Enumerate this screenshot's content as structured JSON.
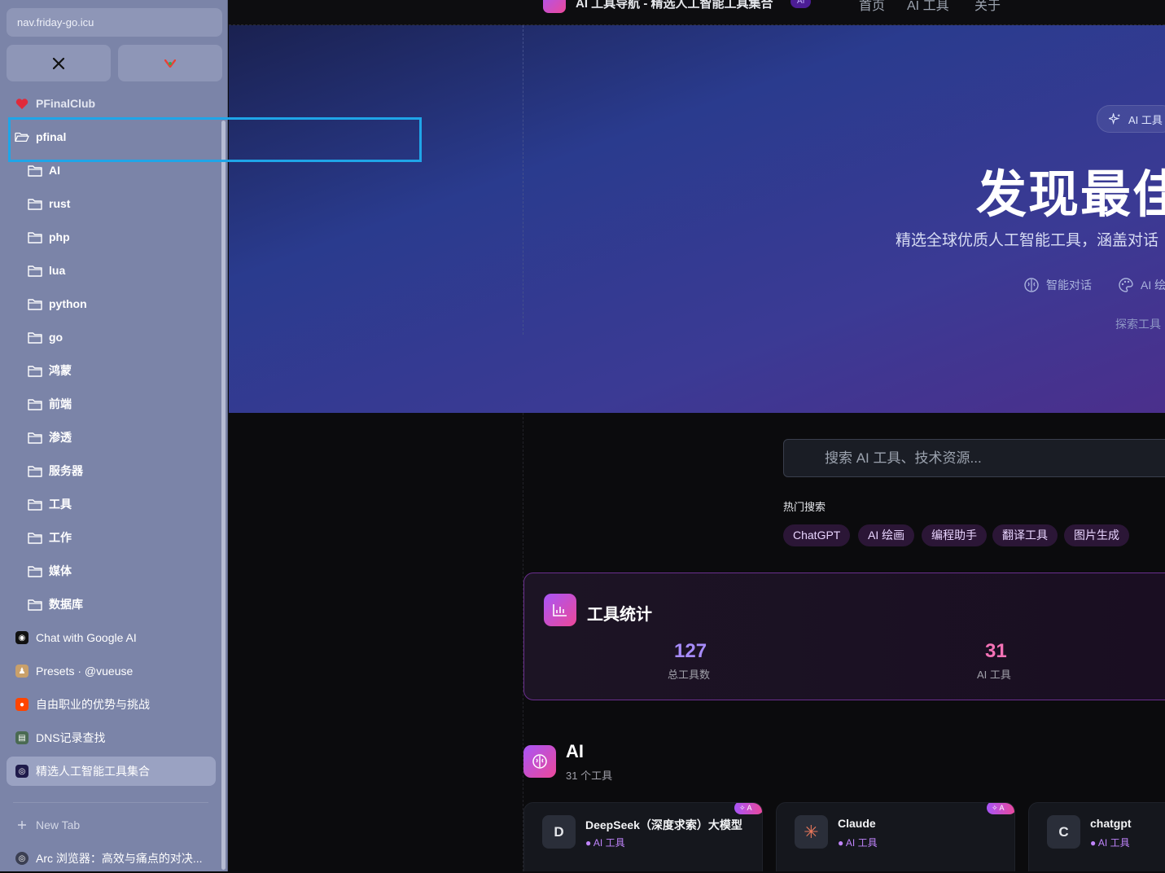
{
  "browser": {
    "url": "nav.friday-go.icu",
    "pinned": [
      {
        "name": "x-icon"
      },
      {
        "name": "google-photos-icon"
      }
    ]
  },
  "sidebar": {
    "top_item": {
      "label": "PFinalClub",
      "icon": "heart-icon"
    },
    "folder": {
      "label": "pfinal",
      "icon": "folder-open-icon"
    },
    "subfolders": [
      "AI",
      "rust",
      "php",
      "lua",
      "python",
      "go",
      "鸿蒙",
      "前端",
      "渗透",
      "服务器",
      "工具",
      "工作",
      "媒体",
      "数据库"
    ],
    "tabs": [
      {
        "label": "Chat with Google AI",
        "icon": "google-ai-icon"
      },
      {
        "label": "Presets · @vueuse",
        "icon": "vueuse-icon"
      },
      {
        "label": "自由职业的优势与挑战",
        "icon": "reddit-icon"
      },
      {
        "label": "DNS记录查找",
        "icon": "dns-icon"
      },
      {
        "label": "精选人工智能工具集合",
        "icon": "ai-nav-icon",
        "active": true
      }
    ],
    "new_tab": "New Tab",
    "bottom_tab": {
      "label": "Arc 浏览器：高效与痛点的对决...",
      "icon": "arc-icon"
    }
  },
  "topnav": {
    "brand": "AI 工具导航 - 精选人工智能工具集合",
    "badge": "AI",
    "links": [
      "首页",
      "AI 工具",
      "关于"
    ]
  },
  "hero": {
    "badge": "AI 工具",
    "title": "发现最佳",
    "subtitle": "精选全球优质人工智能工具，涵盖对话",
    "features": [
      "智能对话",
      "AI 绘"
    ],
    "explore": "探索工具"
  },
  "search": {
    "placeholder": "搜索 AI 工具、技术资源...",
    "hot_label": "热门搜索",
    "hot_chips": [
      "ChatGPT",
      "AI 绘画",
      "编程助手",
      "翻译工具",
      "图片生成"
    ]
  },
  "stats": {
    "title": "工具统计",
    "items": [
      {
        "value": "127",
        "label": "总工具数",
        "color": "#a78bfa"
      },
      {
        "value": "31",
        "label": "AI 工具",
        "color": "#f472b6"
      }
    ]
  },
  "category": {
    "title": "AI",
    "count": "31 个工具",
    "tools": [
      {
        "name": "DeepSeek（深度求索）大模型",
        "avatar": "D",
        "tag": "● AI 工具",
        "badge": "A"
      },
      {
        "name": "Claude",
        "avatar": "✳",
        "tag": "● AI 工具",
        "badge": "A"
      },
      {
        "name": "chatgpt",
        "avatar": "C",
        "tag": "● AI 工具",
        "badge": ""
      }
    ]
  }
}
